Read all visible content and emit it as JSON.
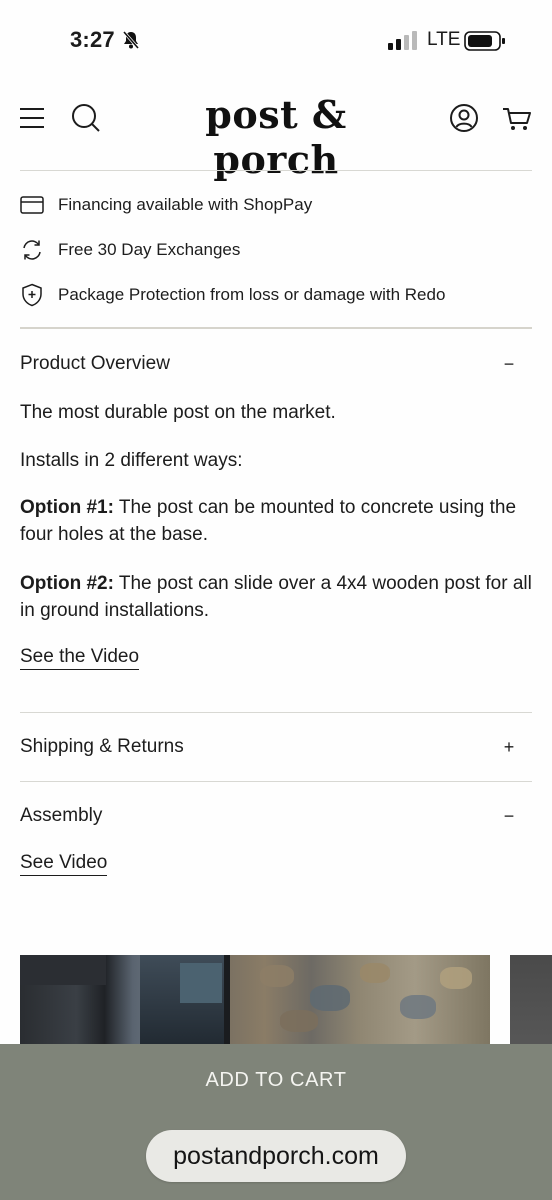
{
  "status_bar": {
    "time": "3:27",
    "network": "LTE",
    "icons": [
      "bell-muted-icon",
      "signal-icon",
      "battery-icon"
    ]
  },
  "header": {
    "logo": "post & porch",
    "icons": [
      "menu-icon",
      "search-icon",
      "account-icon",
      "cart-icon"
    ]
  },
  "perks": [
    {
      "icon": "credit-card-icon",
      "text": "Financing available with ShopPay"
    },
    {
      "icon": "exchange-icon",
      "text": "Free 30 Day Exchanges"
    },
    {
      "icon": "shield-plus-icon",
      "text": "Package Protection from loss or damage with Redo"
    }
  ],
  "overview": {
    "title": "Product Overview",
    "toggle": "−",
    "p1": "The most durable post on the market.",
    "p2": "Installs in 2 different ways:",
    "opt1_label": "Option #1:",
    "opt1_text": " The post can be mounted to concrete using the four holes at the base.",
    "opt2_label": "Option #2:",
    "opt2_text": " The post can slide over a 4x4 wooden post for all in ground installations.",
    "video_link": "See the Video"
  },
  "shipping": {
    "title": "Shipping & Returns",
    "toggle": "+"
  },
  "assembly": {
    "title": "Assembly",
    "toggle": "−",
    "video_link": "See Video"
  },
  "cta": {
    "label": "ADD TO CART"
  },
  "browser": {
    "url": "postandporch.com"
  },
  "colors": {
    "bottom_bar": "#7f8479",
    "divider": "#d6d4cc",
    "text": "#1c1c1c"
  }
}
